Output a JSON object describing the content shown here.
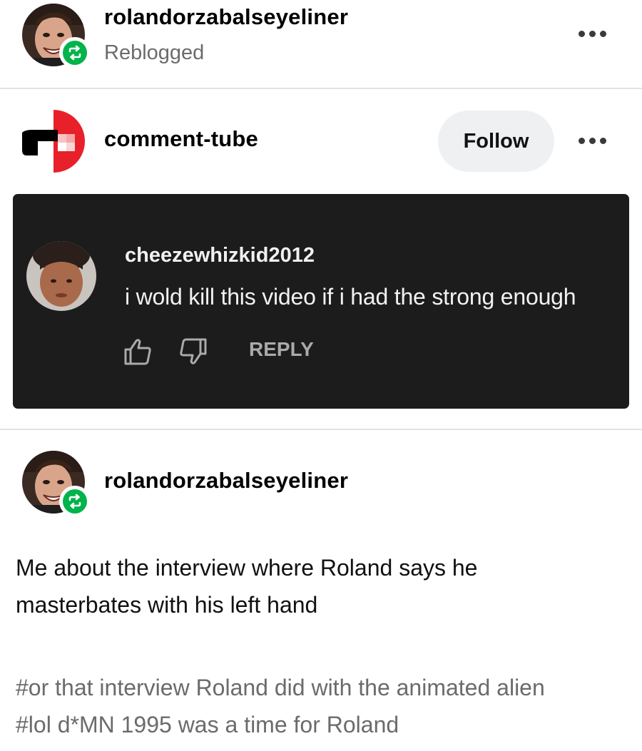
{
  "reblog_header": {
    "username": "rolandorzabalseyeliner",
    "status": "Reblogged",
    "menu_icon": "more-dots-icon"
  },
  "source_post": {
    "username": "comment-tube",
    "follow_label": "Follow",
    "menu_icon": "more-dots-icon",
    "comment_card": {
      "commenter": "cheezewhizkid2012",
      "comment_text": "i wold kill this video if i had the strong enough",
      "like_icon": "thumbs-up-icon",
      "dislike_icon": "thumbs-down-icon",
      "reply_label": "REPLY"
    }
  },
  "reblog_post": {
    "username": "rolandorzabalseyeliner",
    "body_lines": [
      "Me about the interview where Roland says he",
      "masterbates with his left hand"
    ],
    "tags": [
      "#or that interview Roland did with the animated alien",
      "#lol d*MN 1995 was a time for Roland"
    ]
  },
  "colors": {
    "reblog_green": "#00b34a",
    "follow_bg": "#eef0f2",
    "card_bg": "#1c1c1c",
    "muted_text": "#6b6b6b",
    "logo_red": "#e8202a"
  }
}
